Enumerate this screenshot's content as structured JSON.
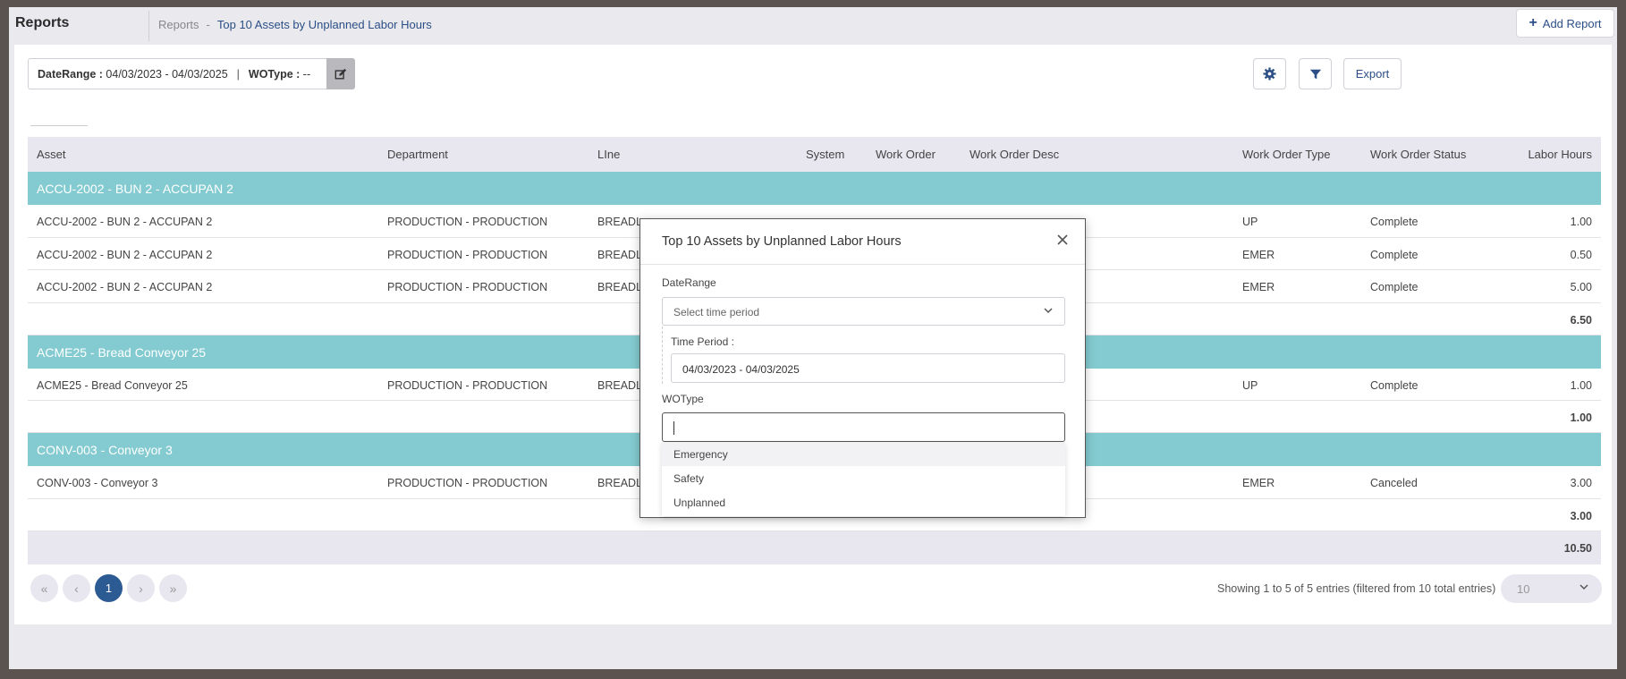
{
  "header": {
    "app_title": "Reports",
    "breadcrumb_root": "Reports",
    "breadcrumb_sep": "-",
    "breadcrumb_current": "Top 10 Assets by Unplanned Labor Hours",
    "add_report_label": "Add Report"
  },
  "filters": {
    "daterange_label": "DateRange :",
    "daterange_value": "04/03/2023 - 04/03/2025",
    "separator": "|",
    "wotype_label": "WOType :",
    "wotype_value": "--"
  },
  "toolbar": {
    "export_label": "Export"
  },
  "table": {
    "columns": [
      "Asset",
      "Department",
      "LIne",
      "System",
      "Work Order",
      "Work Order Desc",
      "Work Order Type",
      "Work Order Status",
      "Labor Hours"
    ],
    "groups": [
      {
        "title": "ACCU-2002 - BUN 2 - ACCUPAN 2",
        "rows": [
          {
            "asset": "ACCU-2002 - BUN 2 - ACCUPAN 2",
            "department": "PRODUCTION - PRODUCTION",
            "line": "BREADL",
            "type": "UP",
            "status": "Complete",
            "hours": "1.00"
          },
          {
            "asset": "ACCU-2002 - BUN 2 - ACCUPAN 2",
            "department": "PRODUCTION - PRODUCTION",
            "line": "BREADL",
            "type": "EMER",
            "status": "Complete",
            "hours": "0.50"
          },
          {
            "asset": "ACCU-2002 - BUN 2 - ACCUPAN 2",
            "department": "PRODUCTION - PRODUCTION",
            "line": "BREADL",
            "type": "EMER",
            "status": "Complete",
            "hours": "5.00"
          }
        ],
        "subtotal": "6.50"
      },
      {
        "title": "ACME25 - Bread Conveyor 25",
        "rows": [
          {
            "asset": "ACME25 - Bread Conveyor 25",
            "department": "PRODUCTION - PRODUCTION",
            "line": "BREADL",
            "type": "UP",
            "status": "Complete",
            "hours": "1.00"
          }
        ],
        "subtotal": "1.00"
      },
      {
        "title": "CONV-003 - Conveyor 3",
        "rows": [
          {
            "asset": "CONV-003 - Conveyor 3",
            "department": "PRODUCTION - PRODUCTION",
            "line": "BREADL",
            "type": "EMER",
            "status": "Canceled",
            "hours": "3.00"
          }
        ],
        "subtotal": "3.00"
      }
    ],
    "grand_total": "10.50"
  },
  "pagination": {
    "current_page": "1",
    "showing_text": "Showing 1 to 5 of 5 entries (filtered from 10 total entries)",
    "page_size": "10"
  },
  "modal": {
    "title": "Top 10 Assets by Unplanned Labor Hours",
    "daterange_label": "DateRange",
    "select_placeholder": "Select time period",
    "time_period_label": "Time Period :",
    "time_period_value": "04/03/2023 - 04/03/2025",
    "wotype_label": "WOType",
    "wotype_input_value": "",
    "options": [
      "Emergency",
      "Safety",
      "Unplanned"
    ]
  },
  "colors": {
    "accent": "#2c4f86",
    "group_row": "#83cbd0",
    "header_bg": "#e8e6ef"
  }
}
